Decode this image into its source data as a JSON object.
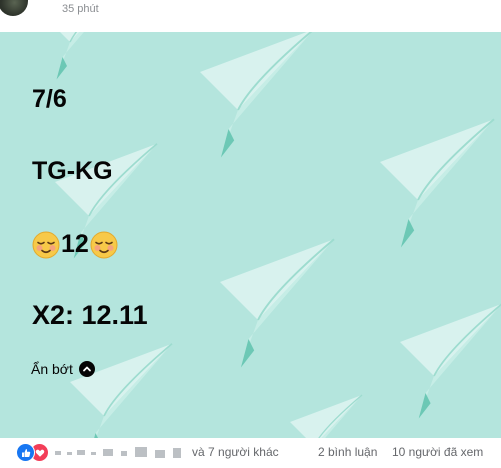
{
  "post": {
    "timestamp": "35 phút",
    "lines": {
      "date": "7/6",
      "teams": "TG-KG",
      "score_value": "12",
      "odds": "X2: 12.11"
    },
    "score_emoji": "relieved-face-icon",
    "see_less_label": "Ẩn bớt",
    "see_less_icon": "chevron-up-icon"
  },
  "footer": {
    "reactions_text": "và 7 người khác",
    "comments_text": "2 bình luận",
    "views_text": "10 người đã xem",
    "reaction_icons": [
      "like-icon",
      "love-icon"
    ]
  },
  "colors": {
    "card_background": "#b4e5dd",
    "plane_fill": "#d8f2ee",
    "plane_shade": "#6cc8b5",
    "text": "#050505",
    "meta_text": "#65676b",
    "like_blue": "#1877f2",
    "love_red": "#f33e58"
  }
}
